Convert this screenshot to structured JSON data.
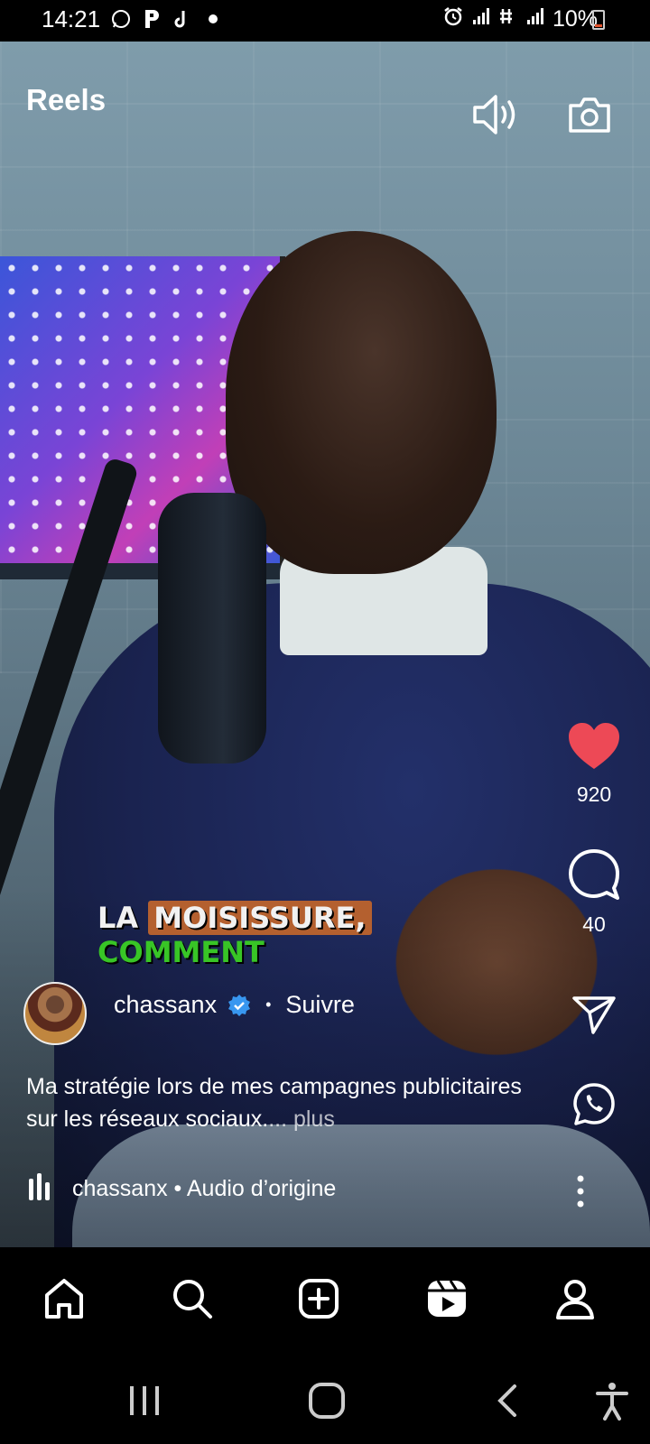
{
  "status_bar": {
    "time": "14:21",
    "battery": "10%",
    "left_icons": [
      "whatsapp-icon",
      "p-icon",
      "tiktok-icon",
      "dot-icon"
    ],
    "right_icons": [
      "alarm-icon",
      "signal-icon",
      "data-icon",
      "signal-icon"
    ]
  },
  "header": {
    "title": "Reels",
    "icons": [
      "speaker-icon",
      "camera-icon"
    ]
  },
  "video": {
    "caption_line1_a": "LA",
    "caption_line1_b": "MOISISSURE,",
    "caption_line2": "COMMENT"
  },
  "actions": {
    "likes": "920",
    "comments": "40",
    "like_color": "#ed4956"
  },
  "author": {
    "username": "chassanx",
    "follow_label": "Suivre",
    "separator": "•"
  },
  "description": {
    "text": "Ma stratégie lors de mes campagnes publicitaires sur les réseaux sociaux.",
    "ellipsis": "...",
    "more_label": " plus"
  },
  "audio": {
    "label": "chassanx • Audio d’origine"
  },
  "bottom_nav": [
    "home-icon",
    "search-icon",
    "create-icon",
    "reels-icon",
    "profile-icon"
  ],
  "system_nav": [
    "recents-icon",
    "home-circle-icon",
    "back-icon",
    "accessibility-icon"
  ]
}
